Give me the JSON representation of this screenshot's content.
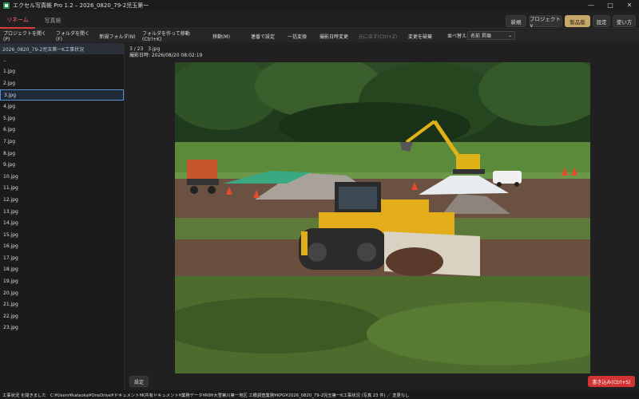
{
  "window": {
    "title": "エクセル写真帳 Pro 1.2 – 2026_0820_79-2児玉第一",
    "controls": [
      "—",
      "□",
      "✕"
    ]
  },
  "tabs": [
    {
      "label": "リネーム",
      "active": true
    },
    {
      "label": "写真帳",
      "active": false
    }
  ],
  "header_buttons": {
    "new": "新規",
    "project": "プロジェクト∨",
    "product": "製品版",
    "settings": "設定",
    "howto": "使い方"
  },
  "toolbar": {
    "open_project": "プロジェクトを開く(P)",
    "open_folder": "フォルダを開く(F)",
    "new_folder": "新規フォルダ(N)",
    "move_to_folder": "フォルダを作って移動(Ctrl+K)",
    "move": "移動(M)",
    "batch_settings": "連番で設定",
    "batch_convert": "一括変換",
    "change_date": "撮影日時変更",
    "undo": "元に戻す(Ctrl+Z)",
    "discard": "変更を破棄",
    "sort_label": "並べ替え:",
    "sort_value": "名前 昇順"
  },
  "sidebar": {
    "folder": "2026_0820_79-2児玉第一K工事状況",
    "files": [
      "..",
      "1.jpg",
      "2.jpg",
      "3.jpg",
      "4.jpg",
      "5.jpg",
      "6.jpg",
      "7.jpg",
      "8.jpg",
      "9.jpg",
      "10.jpg",
      "11.jpg",
      "12.jpg",
      "13.jpg",
      "14.jpg",
      "15.jpg",
      "16.jpg",
      "17.jpg",
      "18.jpg",
      "19.jpg",
      "20.jpg",
      "21.jpg",
      "22.jpg",
      "23.jpg"
    ],
    "selected": "3.jpg"
  },
  "viewer": {
    "index": "3 / 23　3.jpg",
    "taken": "撮影日時: 2026/08/20 08:02:19"
  },
  "buttons": {
    "settings": "設定",
    "write": "書き込み(Ctrl+S)"
  },
  "status": "工事状況 を開きました　C:¥Users¥kataoka¥OneDrive¥ドキュメント¥K共有ドキュメント¥業務データ¥R8¥大雪第川第一地区 工概調査業務¥KPG¥2026_0820_79-2児玉第一K工事状況 (写真 23 件) ／ 変更なし",
  "colors": {
    "accent": "#e23b3b",
    "write_button": "#d23434",
    "product_button": "#c7a96a",
    "selection": "#5a8fd6"
  }
}
